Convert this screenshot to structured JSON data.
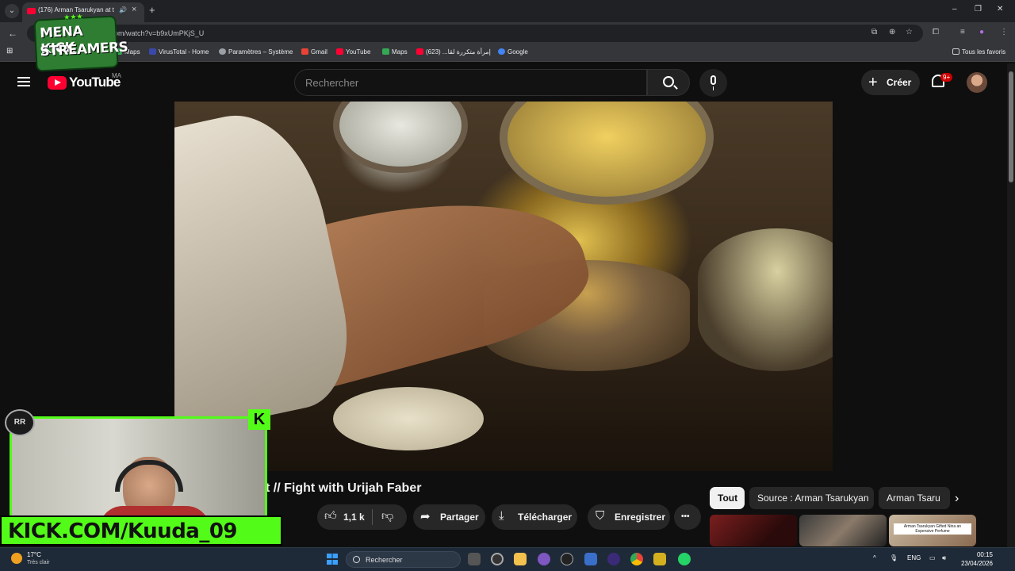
{
  "browser": {
    "tab_title": "(176) Arman Tsarukyan at th",
    "new_tab": "+",
    "url": "om/watch?v=b9xUmPKjS_U",
    "window_controls": [
      "–",
      "❐",
      "✕"
    ],
    "bookmarks": [
      {
        "label": "Maps",
        "icon_color": "#34a853"
      },
      {
        "label": "VirusTotal - Home",
        "icon_color": "#3949ab"
      },
      {
        "label": "Paramètres – Système",
        "icon_color": "#9aa0a6"
      },
      {
        "label": "Gmail",
        "icon_color": "#ea4335"
      },
      {
        "label": "YouTube",
        "icon_color": "#ff0033"
      },
      {
        "label": "Maps",
        "icon_color": "#34a853"
      },
      {
        "label": "إمرأة متكررة لقا... (623)",
        "icon_color": "#ff0033"
      },
      {
        "label": "Google",
        "icon_color": "#4285f4"
      }
    ],
    "all_bookmarks": "Tous les favoris"
  },
  "youtube": {
    "logo_text": "YouTube",
    "country_code": "MA",
    "search_placeholder": "Rechercher",
    "create_label": "Créer",
    "notif_badge": "9+",
    "video_title": "t // Fight with Urijah Faber",
    "like_count": "1,1 k",
    "share_label": "Partager",
    "download_label": "Télécharger",
    "save_label": "Enregistrer",
    "more": "•••",
    "chips": [
      "Tout",
      "Source : Arman Tsarukyan",
      "Arman Tsaru"
    ],
    "thumb3_caption": "Arman Tsarukyan Gifted Nina an Expensive Perfume"
  },
  "overlay": {
    "logo_line1": "MENA KICK",
    "logo_line2": "STREAMERS",
    "kick_url": "KICK.COM/Kuuda_09",
    "k_badge": "K",
    "circle_logo": "RR"
  },
  "taskbar": {
    "temp": "17°C",
    "weather": "Très clair",
    "search": "Rechercher",
    "lang": "ENG",
    "time": "00:15",
    "date": "23/04/2026"
  },
  "colors": {
    "kick_green": "#53fc18",
    "yt_red": "#ff0033",
    "bg": "#0f0f0f"
  }
}
